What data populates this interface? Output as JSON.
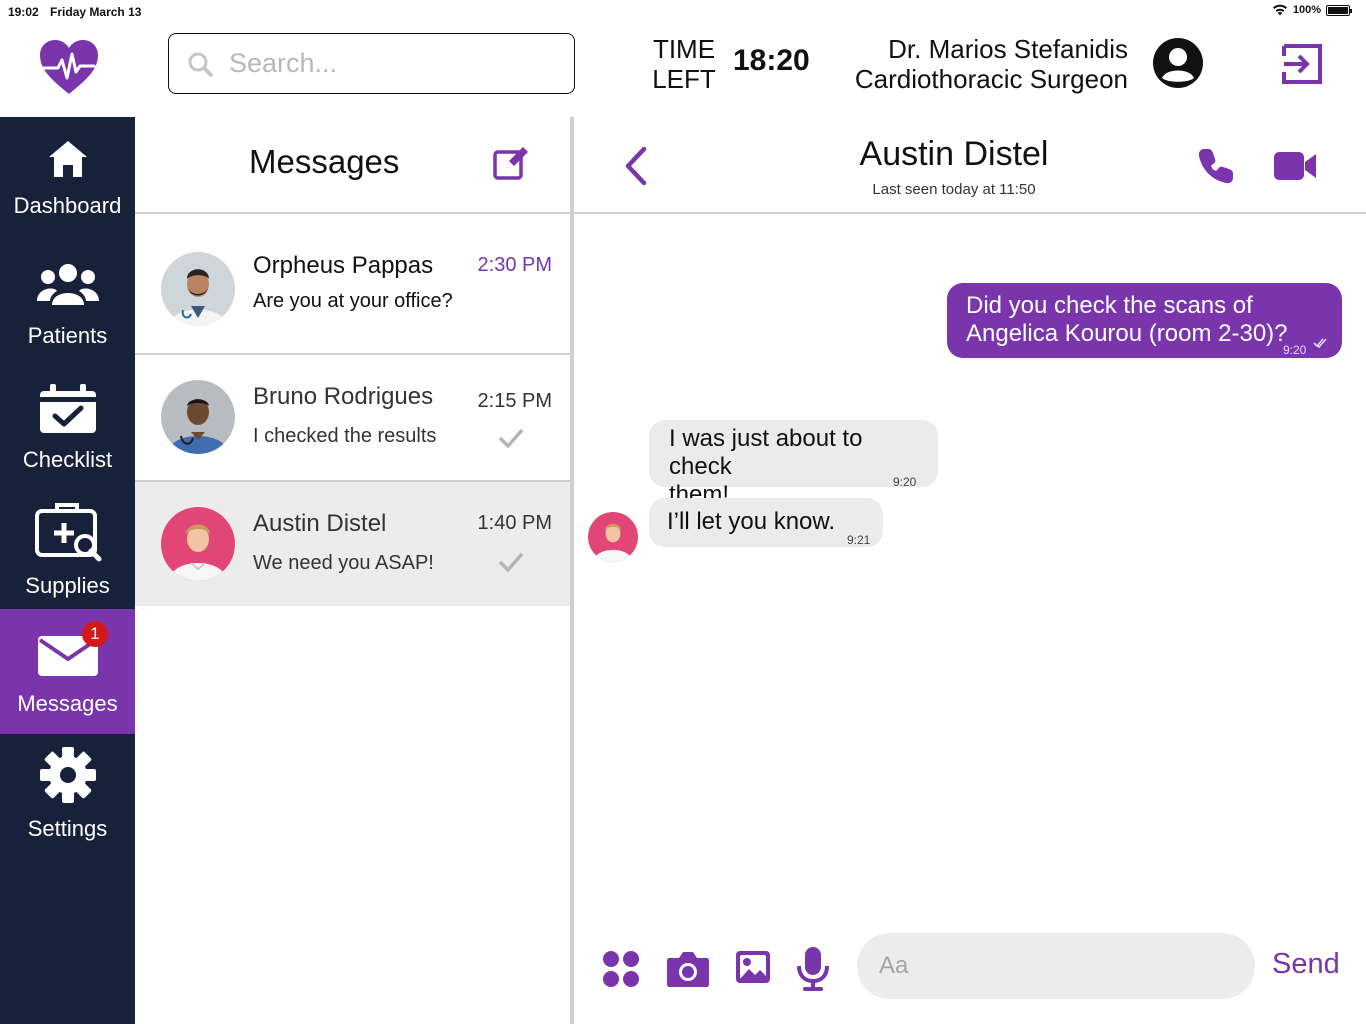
{
  "status": {
    "time": "19:02",
    "date": "Friday March 13",
    "battery": "100%",
    "battery_level": 1.0
  },
  "header": {
    "search_placeholder": "Search...",
    "time_left_label_1": "TIME",
    "time_left_label_2": "LEFT",
    "time_left_value": "18:20",
    "doctor_name": "Dr. Marios Stefanidis",
    "doctor_role": "Cardiothoracic Surgeon"
  },
  "sidebar": {
    "items": [
      {
        "label": "Dashboard",
        "icon": "home-icon"
      },
      {
        "label": "Patients",
        "icon": "users-icon"
      },
      {
        "label": "Checklist",
        "icon": "calendar-check-icon"
      },
      {
        "label": "Supplies",
        "icon": "medical-supplies-icon"
      },
      {
        "label": "Messages",
        "icon": "envelope-icon",
        "active": true,
        "badge": "1"
      },
      {
        "label": "Settings",
        "icon": "gear-icon"
      }
    ]
  },
  "messages_list": {
    "title": "Messages",
    "conversations": [
      {
        "name": "Orpheus Pappas",
        "preview": "Are you at your office?",
        "time": "2:30 PM",
        "unread": true
      },
      {
        "name": "Bruno Rodrigues",
        "preview": "I checked the results",
        "time": "2:15 PM",
        "read": true
      },
      {
        "name": "Austin Distel",
        "preview": "We need you ASAP!",
        "time": "1:40 PM",
        "read": true,
        "selected": true
      }
    ]
  },
  "chat": {
    "contact_name": "Austin Distel",
    "last_seen": "Last seen today at 11:50",
    "messages": [
      {
        "direction": "out",
        "text_line1": "Did you check the scans of",
        "text_line2": "Angelica Kourou (room 2-30)?",
        "time": "9:20"
      },
      {
        "direction": "in",
        "text_line1": "I was just about to check",
        "text_line2": "them!",
        "time": "9:20"
      },
      {
        "direction": "in",
        "text_line1": "I’ll let you know.",
        "time": "9:21"
      }
    ],
    "input_placeholder": "Aa",
    "send_label": "Send"
  },
  "colors": {
    "accent": "#7a35ad",
    "sidebar": "#172139",
    "badge": "#d31a1a",
    "bubble_in": "#ebebeb"
  }
}
